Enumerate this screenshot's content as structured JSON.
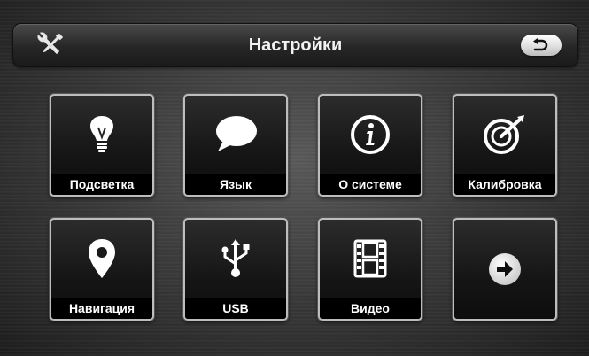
{
  "header": {
    "title": "Настройки",
    "settings_icon": "tools-icon",
    "back_icon": "back-arrow-icon"
  },
  "tiles": [
    {
      "label": "Подсветка",
      "icon": "lightbulb-icon"
    },
    {
      "label": "Язык",
      "icon": "speech-bubble-icon"
    },
    {
      "label": "О системе",
      "icon": "info-icon"
    },
    {
      "label": "Калибровка",
      "icon": "calibration-target-icon"
    },
    {
      "label": "Навигация",
      "icon": "map-pin-icon"
    },
    {
      "label": "USB",
      "icon": "usb-icon"
    },
    {
      "label": "Видео",
      "icon": "film-strip-icon"
    },
    {
      "label": "",
      "icon": "next-arrow-icon"
    }
  ],
  "colors": {
    "icon": "#ffffff",
    "label_bg": "#000000",
    "tile_border": "#bdbdbd"
  }
}
